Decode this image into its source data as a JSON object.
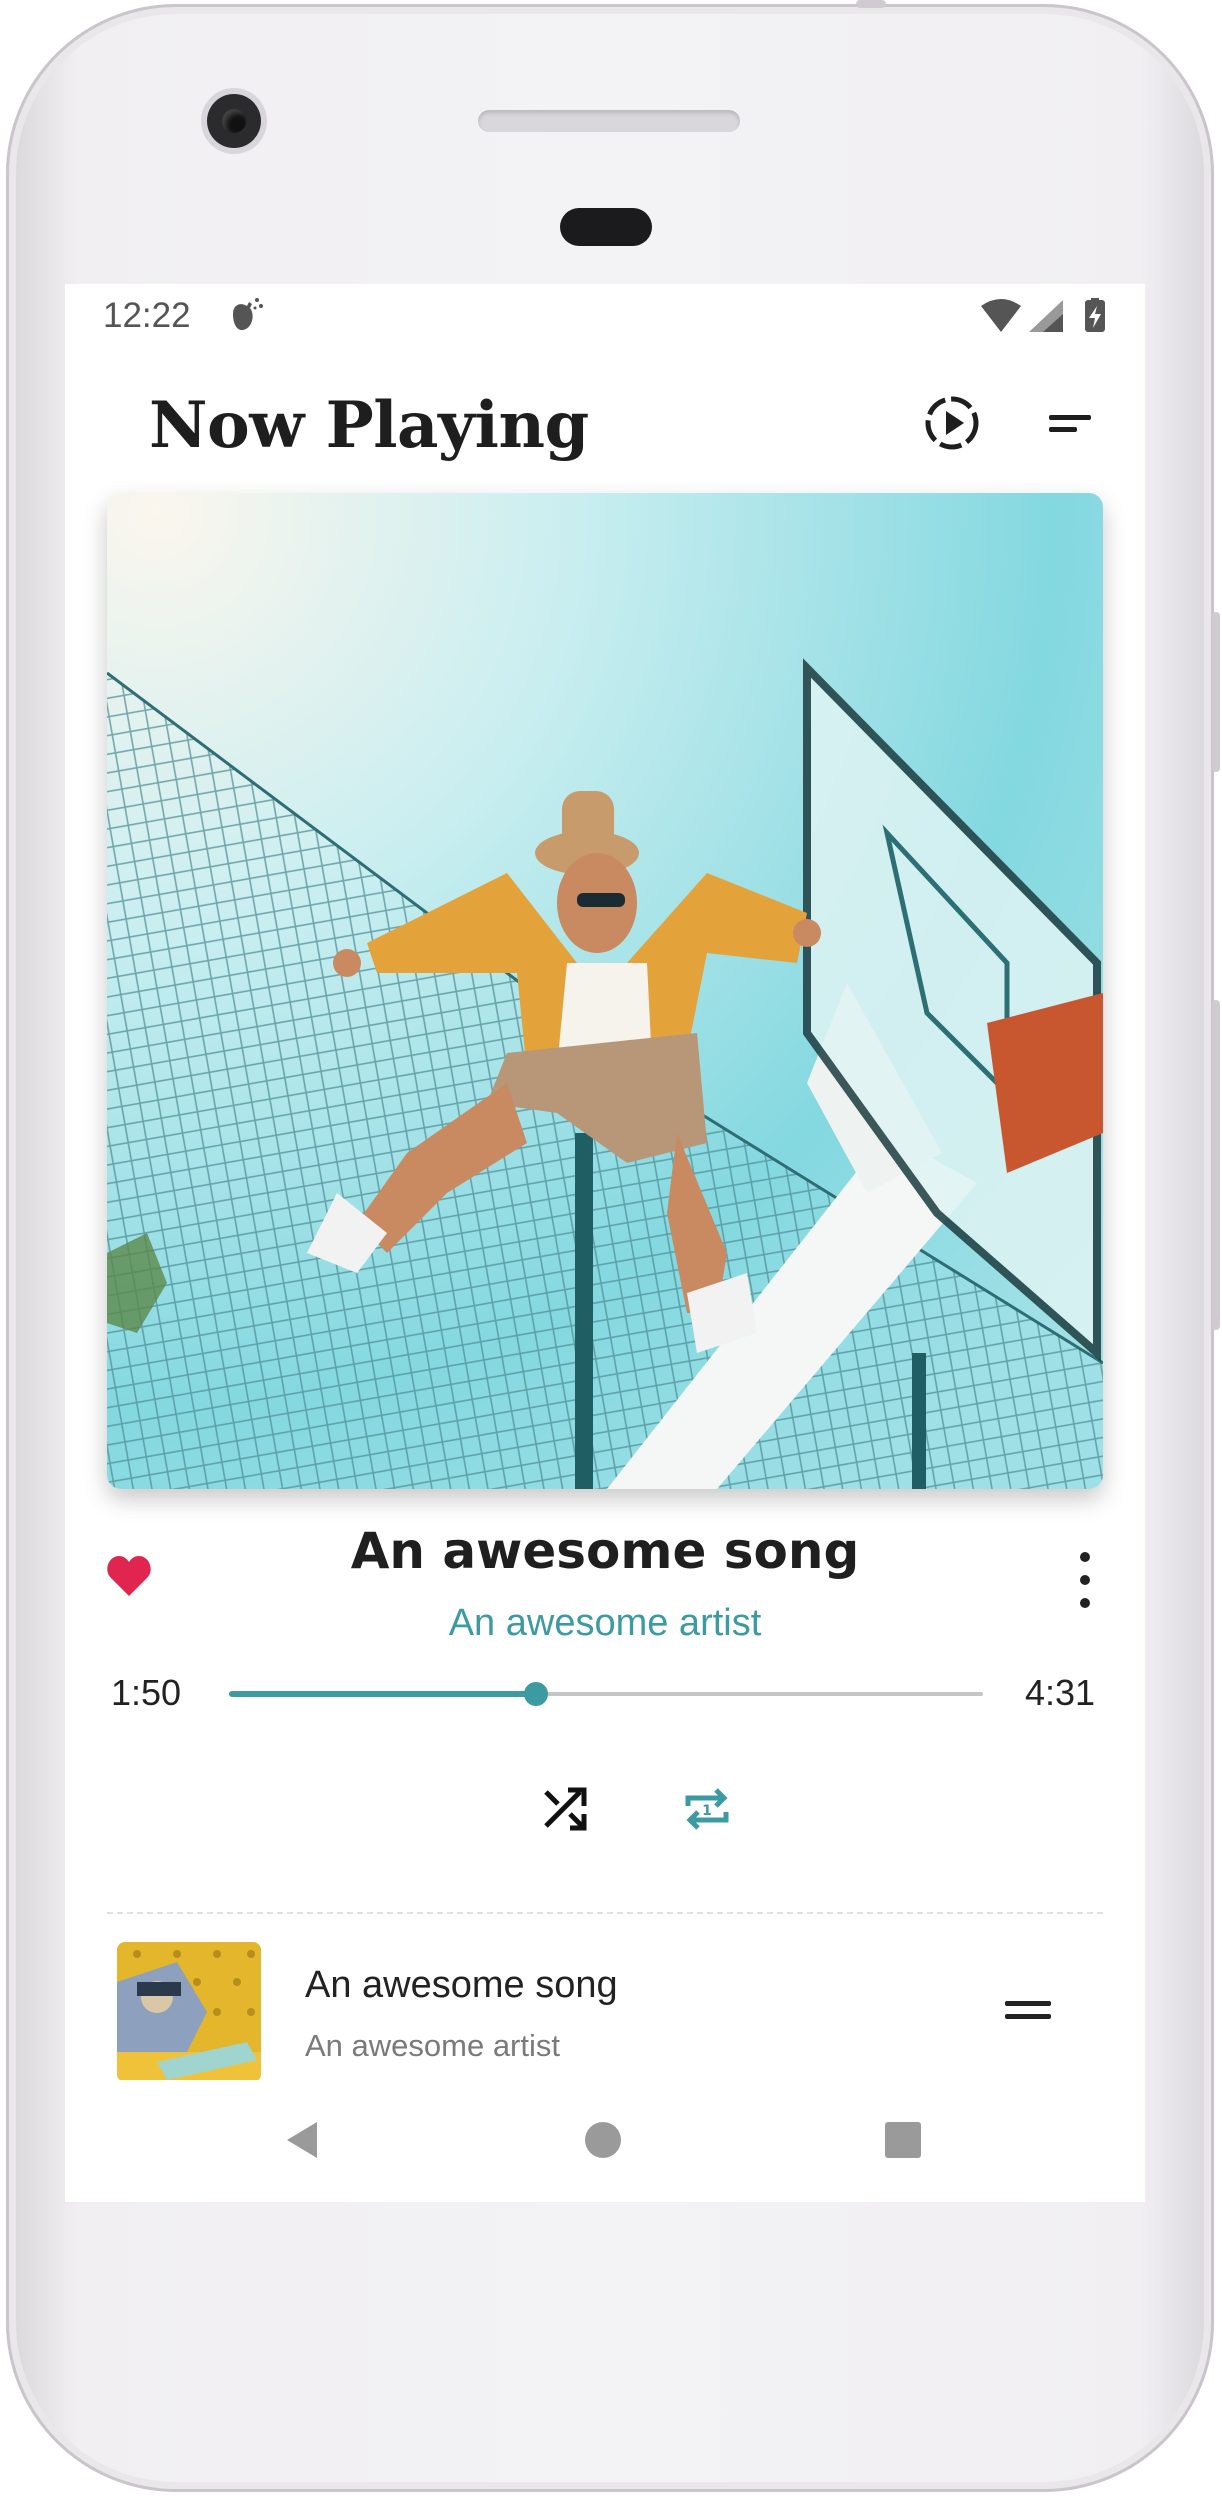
{
  "status_bar": {
    "time": "12:22"
  },
  "app_bar": {
    "title": "Now Playing"
  },
  "now_playing": {
    "song_title": "An awesome song",
    "artist": "An awesome artist",
    "elapsed": "1:50",
    "duration": "4:31",
    "progress_fraction": 0.407,
    "liked": true,
    "shuffle_on": false,
    "repeat_mode": "one"
  },
  "queue": [
    {
      "title": "An awesome song",
      "artist": "An awesome artist"
    }
  ],
  "colors": {
    "accent": "#3b9ba0",
    "heart": "#e0254f",
    "text_primary": "#1f1f1f",
    "text_secondary": "#7a7a7a"
  },
  "icons": {
    "status_notification": "bug-notification-icon",
    "status_wifi": "wifi-icon",
    "status_signal": "cell-signal-icon",
    "status_battery": "battery-charging-icon",
    "app_bar_queue": "play-circle-dashed-icon",
    "app_bar_menu": "menu-lines-icon",
    "favorite": "heart-icon",
    "more": "more-vert-icon",
    "shuffle": "shuffle-icon",
    "repeat": "repeat-one-icon",
    "drag": "drag-handle-icon",
    "nav_back": "back-triangle-icon",
    "nav_home": "home-circle-icon",
    "nav_recents": "recents-square-icon"
  }
}
